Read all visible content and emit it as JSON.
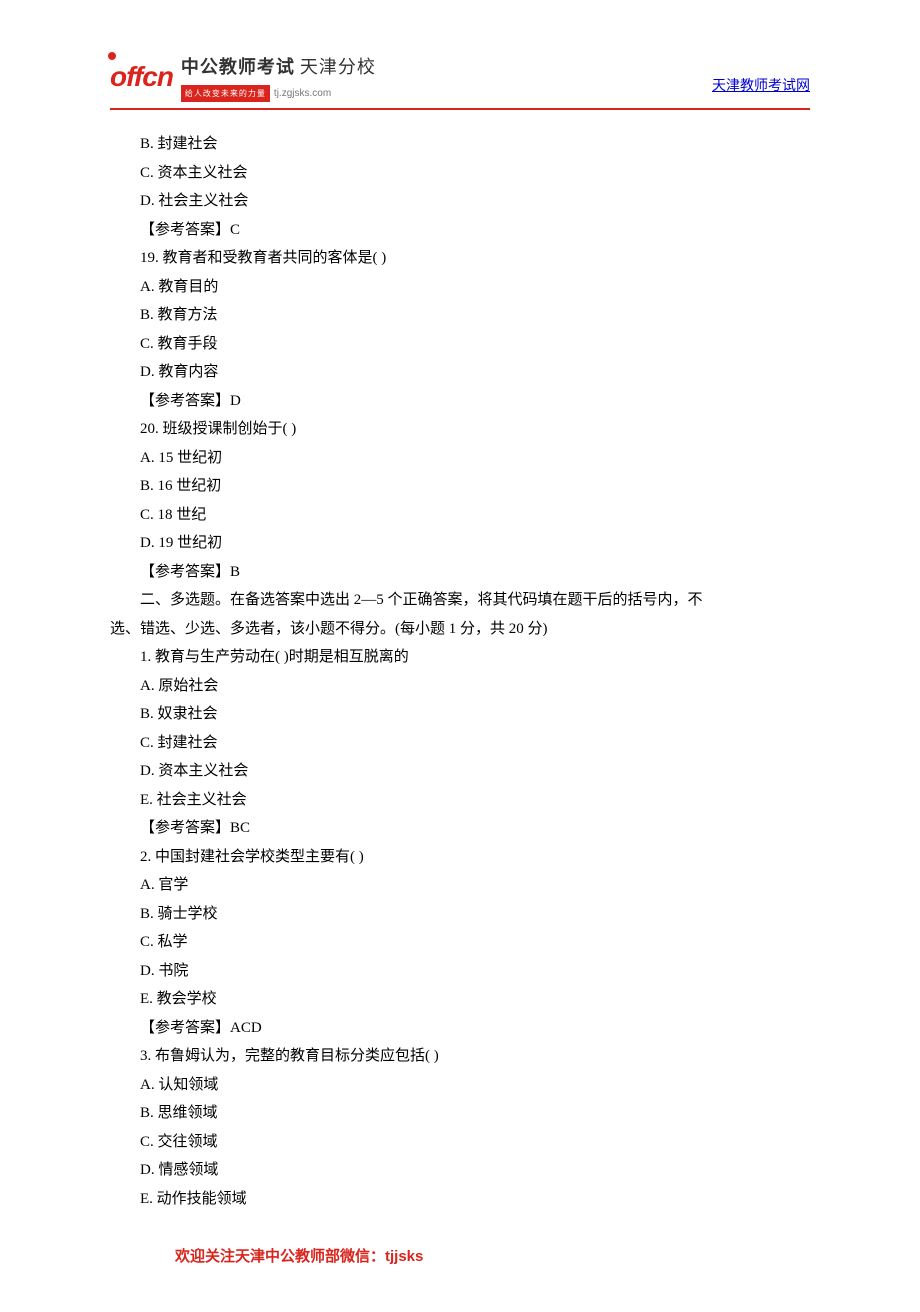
{
  "header": {
    "logo_text": "offcn",
    "brand_main": "中公教师考试",
    "brand_branch": "天津分校",
    "brand_tagline": "给人改变未来的力量",
    "brand_url": "tj.zgjsks.com",
    "link_text": "天津教师考试网"
  },
  "content": {
    "lines": [
      "B. 封建社会",
      "C. 资本主义社会",
      "D. 社会主义社会",
      "【参考答案】C",
      "19. 教育者和受教育者共同的客体是( )",
      "A. 教育目的",
      "B. 教育方法",
      "C. 教育手段",
      "D. 教育内容",
      "【参考答案】D",
      "20. 班级授课制创始于( )",
      "A. 15 世纪初",
      "B. 16 世纪初",
      "C. 18 世纪",
      "D. 19 世纪初",
      "【参考答案】B"
    ],
    "section2_intro_line1": "二、多选题。在备选答案中选出 2—5 个正确答案，将其代码填在题干后的括号内，不",
    "section2_intro_line2": "选、错选、少选、多选者，该小题不得分。(每小题 1 分，共 20 分)",
    "lines2": [
      "1. 教育与生产劳动在( )时期是相互脱离的",
      "A. 原始社会",
      "B. 奴隶社会",
      "C. 封建社会",
      "D. 资本主义社会",
      "E. 社会主义社会",
      "【参考答案】BC",
      "2. 中国封建社会学校类型主要有( )",
      "A. 官学",
      "B. 骑士学校",
      "C. 私学",
      "D. 书院",
      "E. 教会学校",
      "【参考答案】ACD",
      "3. 布鲁姆认为，完整的教育目标分类应包括( )",
      "A. 认知领域",
      "B. 思维领域",
      "C. 交往领域",
      "D. 情感领域",
      "E. 动作技能领域"
    ]
  },
  "footer": {
    "text": "欢迎关注天津中公教师部微信：tjjsks"
  }
}
